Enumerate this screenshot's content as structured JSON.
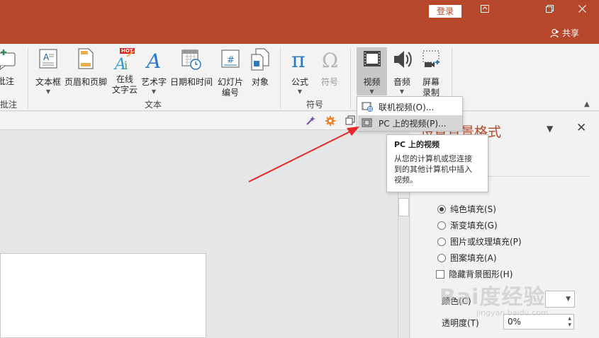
{
  "titlebar": {
    "login_label": "登录",
    "share_label": "共享",
    "accent_color": "#b7472a"
  },
  "ribbon": {
    "comment": "批注",
    "comment_group": "批注",
    "textbox": "文本框",
    "header_footer": "页眉和页脚",
    "wordcloud_line1": "在线",
    "wordcloud_line2": "文字云",
    "wordcloud_badge": "HOT",
    "wordart": "艺术字",
    "datetime": "日期和时间",
    "slide_number_line1": "幻灯片",
    "slide_number_line2": "编号",
    "object": "对象",
    "text_group": "文本",
    "equation": "公式",
    "symbol": "符号",
    "symbol_group": "符号",
    "video": "视频",
    "audio": "音频",
    "screen_record_line1": "屏幕",
    "screen_record_line2": "录制"
  },
  "dropdown": {
    "online_video": "联机视频(O)...",
    "pc_video": "PC 上的视频(P)..."
  },
  "tooltip": {
    "title": "PC 上的视频",
    "body": "从您的计算机或您连接\n到的其他计算机中插入\n视频。"
  },
  "pane": {
    "title": "设置背景格式",
    "solid_fill": "纯色填充(S)",
    "gradient_fill": "渐变填充(G)",
    "picture_fill": "图片或纹理填充(P)",
    "pattern_fill": "图案填充(A)",
    "hide_bg": "隐藏背景图形(H)",
    "color_label": "颜色(C)",
    "transparency_label": "透明度(T)",
    "transparency_value": "0%"
  },
  "watermark": {
    "text": "Bai度经验",
    "sub": "jingyan.baidu.com"
  }
}
